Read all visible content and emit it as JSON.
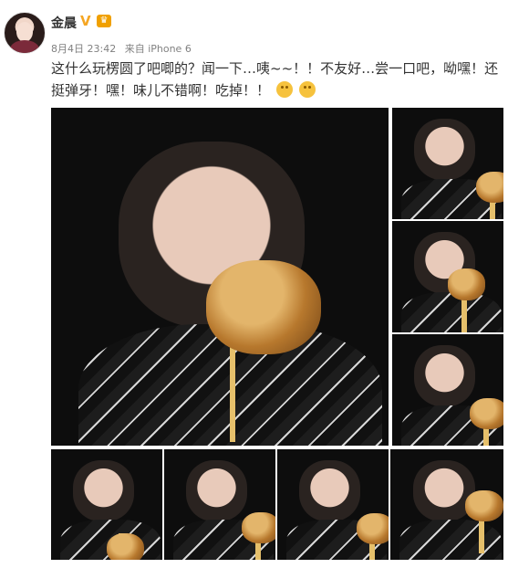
{
  "user": {
    "name": "金晨",
    "verified_badge": "V",
    "membership_icon": "crown-icon"
  },
  "post": {
    "date": "8月4日 23:42",
    "source": "来自 iPhone 6",
    "text": "这什么玩楞圆了吧唧的？闻一下…咦~~！！不友好…尝一口吧，呦嘿！还挺弹牙！嘿！味儿不错啊！吃掉！！",
    "emojis": [
      "doge-icon",
      "doge-icon"
    ]
  }
}
